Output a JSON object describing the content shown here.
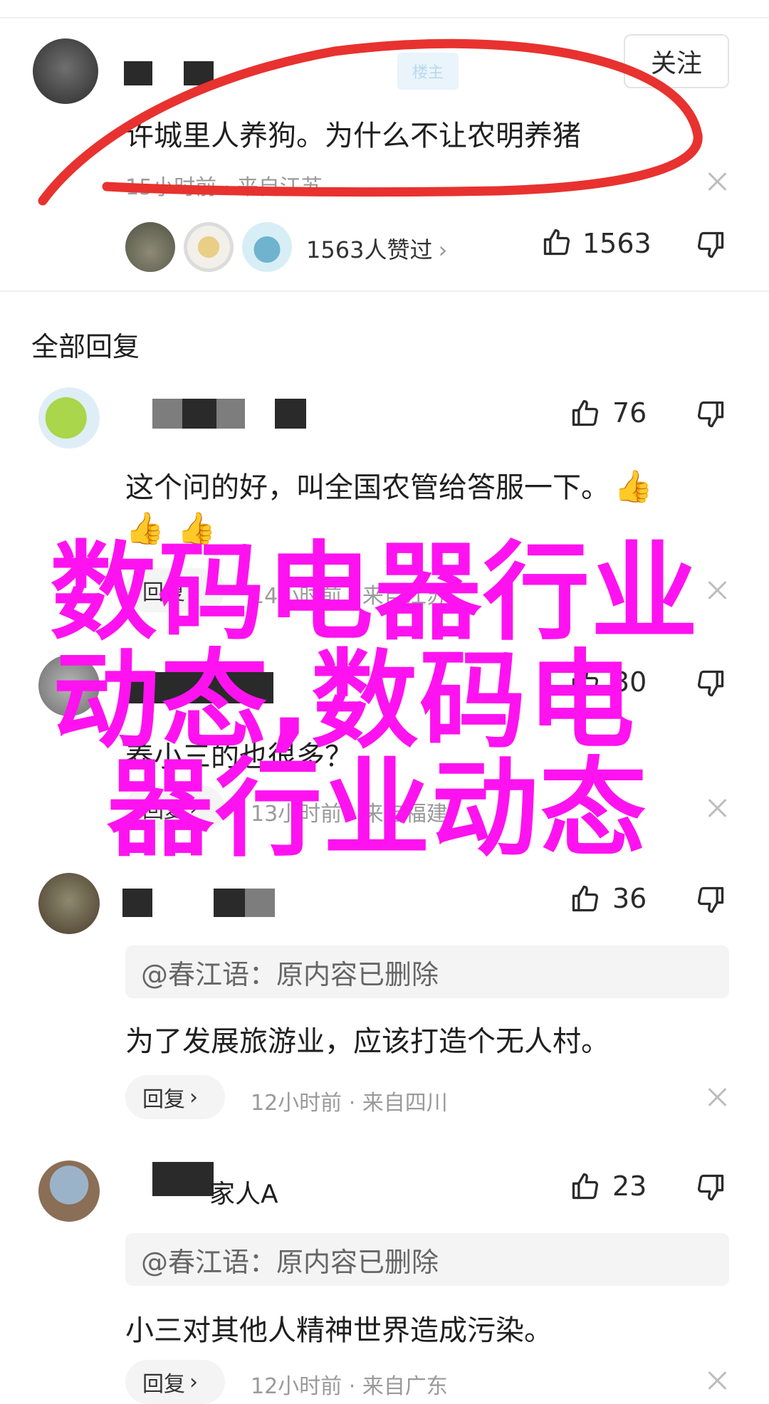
{
  "top_comment": {
    "follow_label": "关注",
    "author_tag": "楼主",
    "text": "许城里人养狗。为什么不让农明养猪",
    "meta": "15小时前 · 来自江苏",
    "likers_text": "1563人赞过",
    "like_count": "1563"
  },
  "section_title": "全部回复",
  "replies": [
    {
      "like_count": "76",
      "text_line1": "这个问的好，叫全国农管给答服一下。",
      "reply_label": "回复",
      "meta": "14小时前 · 来自江苏"
    },
    {
      "like_count": "30",
      "text": "养小三的也很多？",
      "reply_label": "回复",
      "meta": "13小时前 · 来自福建"
    },
    {
      "like_count": "36",
      "quote": "@春江语：原内容已删除",
      "text": "为了发展旅游业，应该打造个无人村。",
      "reply_label": "回复",
      "meta": "12小时前 · 来自四川"
    },
    {
      "author_partial": "家人A",
      "like_count": "23",
      "quote": "@春江语：原内容已删除",
      "text": "小三对其他人精神世界造成污染。",
      "reply_label": "回复",
      "meta": "12小时前 · 来自广东"
    }
  ],
  "overlay": {
    "line1": "数码电器行业",
    "line2": "动态,数码电",
    "line3": "器行业动态",
    "color": "#ff12f0"
  },
  "annotation_color": "#e8322f"
}
